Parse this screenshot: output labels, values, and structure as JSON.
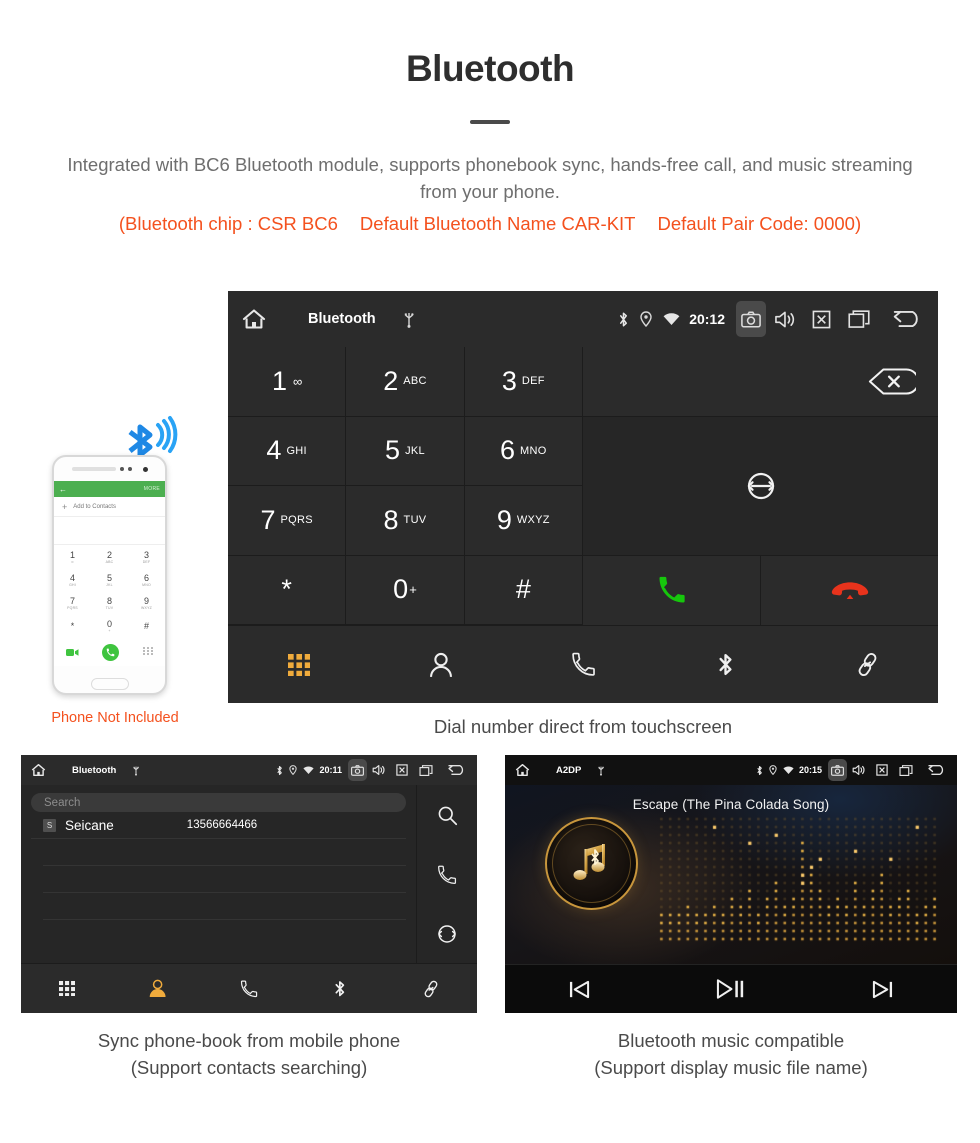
{
  "header": {
    "title": "Bluetooth",
    "subtitle": "Integrated with BC6 Bluetooth module, supports phonebook sync, hands-free call, and music streaming from your phone.",
    "spec_open": "(Bluetooth chip : CSR BC6",
    "spec_name": "Default Bluetooth Name CAR-KIT",
    "spec_pair": "Default Pair Code: 0000)"
  },
  "main_device": {
    "statusbar": {
      "home_icon": "home-icon",
      "title": "Bluetooth",
      "usb_icon": "usb-icon",
      "bluetooth_icon": "bluetooth-icon",
      "location_icon": "location-icon",
      "wifi_icon": "wifi-icon",
      "time": "20:12",
      "camera_icon": "camera-icon",
      "volume_icon": "volume-icon",
      "mute_icon": "mute-icon",
      "recents_icon": "recents-icon",
      "back_icon": "back-icon"
    },
    "keys": [
      {
        "digit": "1",
        "sub": "∞",
        "kind": "voicemail"
      },
      {
        "digit": "2",
        "sub": "ABC",
        "kind": "letters"
      },
      {
        "digit": "3",
        "sub": "DEF",
        "kind": "letters"
      },
      {
        "digit": "4",
        "sub": "GHI",
        "kind": "letters"
      },
      {
        "digit": "5",
        "sub": "JKL",
        "kind": "letters"
      },
      {
        "digit": "6",
        "sub": "MNO",
        "kind": "letters"
      },
      {
        "digit": "7",
        "sub": "PQRS",
        "kind": "letters"
      },
      {
        "digit": "8",
        "sub": "TUV",
        "kind": "letters"
      },
      {
        "digit": "9",
        "sub": "WXYZ",
        "kind": "letters"
      },
      {
        "digit": "*",
        "sub": "",
        "kind": "plain"
      },
      {
        "digit": "0",
        "sub": "+",
        "kind": "sup"
      },
      {
        "digit": "#",
        "sub": "",
        "kind": "plain"
      }
    ],
    "side": {
      "delete_icon": "backspace-icon",
      "sync_icon": "sync-icon",
      "call_icon": "call-icon",
      "hangup_icon": "hangup-icon",
      "call_color": "#16c60c",
      "hangup_color": "#e8331c"
    },
    "bottom_nav": [
      {
        "name": "keypad-icon",
        "active": true
      },
      {
        "name": "contacts-icon",
        "active": false
      },
      {
        "name": "call-log-icon",
        "active": false
      },
      {
        "name": "bluetooth-icon",
        "active": false
      },
      {
        "name": "link-icon",
        "active": false
      }
    ],
    "active_color": "#f0ab3c",
    "caption": "Dial number direct from touchscreen"
  },
  "phone_illustration": {
    "green_back": "←",
    "green_more": "MORE",
    "add_plus": "+",
    "add_label": "Add to Contacts",
    "keys": [
      {
        "digit": "1",
        "sub": "∞"
      },
      {
        "digit": "2",
        "sub": "ABC"
      },
      {
        "digit": "3",
        "sub": "DEF"
      },
      {
        "digit": "4",
        "sub": "GHI"
      },
      {
        "digit": "5",
        "sub": "JKL"
      },
      {
        "digit": "6",
        "sub": "MNO"
      },
      {
        "digit": "7",
        "sub": "PQRS"
      },
      {
        "digit": "8",
        "sub": "TUV"
      },
      {
        "digit": "9",
        "sub": "WXYZ"
      },
      {
        "digit": "*",
        "sub": ""
      },
      {
        "digit": "0",
        "sub": "+"
      },
      {
        "digit": "#",
        "sub": ""
      }
    ],
    "note": "Phone Not Included",
    "note_color": "#f4511e",
    "bluetooth_wave_color": "#1e88e5"
  },
  "phonebook_device": {
    "statusbar": {
      "title": "Bluetooth",
      "time": "20:11"
    },
    "search_placeholder": "Search",
    "contacts": [
      {
        "initial": "S",
        "name": "Seicane",
        "number": "13566664466"
      }
    ],
    "side_icons": [
      {
        "name": "search-icon"
      },
      {
        "name": "call-icon"
      },
      {
        "name": "sync-icon"
      }
    ],
    "bottom_nav": [
      {
        "name": "keypad-icon",
        "active": false
      },
      {
        "name": "contacts-icon",
        "active": true
      },
      {
        "name": "call-log-icon",
        "active": false
      },
      {
        "name": "bluetooth-icon",
        "active": false
      },
      {
        "name": "link-icon",
        "active": false
      }
    ],
    "caption_line1": "Sync phone-book from mobile phone",
    "caption_line2": "(Support contacts searching)"
  },
  "music_device": {
    "statusbar": {
      "title": "A2DP",
      "time": "20:15"
    },
    "track_title": "Escape (The Pina Colada Song)",
    "album_icon": "music-bluetooth-icon",
    "equalizer": {
      "columns": 32,
      "rows": 16,
      "levels": [
        4,
        4,
        4,
        5,
        4,
        4,
        5,
        4,
        6,
        5,
        7,
        4,
        6,
        8,
        5,
        6,
        13,
        9,
        7,
        5,
        6,
        5,
        8,
        5,
        7,
        9,
        5,
        6,
        7,
        4,
        5,
        6
      ]
    },
    "controls": [
      {
        "name": "previous-track-button",
        "glyph": "prev"
      },
      {
        "name": "play-pause-button",
        "glyph": "playpause"
      },
      {
        "name": "next-track-button",
        "glyph": "next"
      }
    ],
    "accent_color": "#c8963c",
    "caption_line1": "Bluetooth music compatible",
    "caption_line2": "(Support display music file name)"
  }
}
